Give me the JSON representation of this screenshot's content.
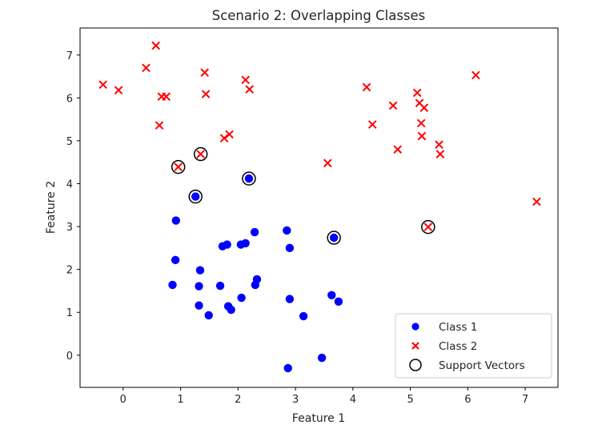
{
  "chart_data": {
    "type": "scatter",
    "title": "Scenario 2: Overlapping Classes",
    "xlabel": "Feature 1",
    "ylabel": "Feature 2",
    "xlim": [
      -0.75,
      7.57
    ],
    "ylim": [
      -0.75,
      7.63
    ],
    "xticks": [
      0,
      1,
      2,
      3,
      4,
      5,
      6,
      7
    ],
    "yticks": [
      0,
      1,
      2,
      3,
      4,
      5,
      6,
      7
    ],
    "grid": false,
    "legend_position": "bottom-right",
    "legend": [
      {
        "label": "Class 1",
        "marker": "circle-filled",
        "color": "#0000ff"
      },
      {
        "label": "Class 2",
        "marker": "x",
        "color": "#ff0000"
      },
      {
        "label": "Support Vectors",
        "marker": "circle-open",
        "color": "#000000"
      }
    ],
    "series": [
      {
        "name": "Class 1",
        "marker": "circle-filled",
        "color": "#0000ff",
        "points": [
          [
            0.92,
            3.14
          ],
          [
            2.29,
            2.87
          ],
          [
            2.85,
            2.91
          ],
          [
            1.73,
            2.54
          ],
          [
            1.81,
            2.58
          ],
          [
            2.05,
            2.58
          ],
          [
            2.13,
            2.61
          ],
          [
            2.9,
            2.5
          ],
          [
            0.91,
            2.22
          ],
          [
            1.34,
            1.98
          ],
          [
            0.86,
            1.64
          ],
          [
            1.32,
            1.61
          ],
          [
            1.69,
            1.62
          ],
          [
            2.33,
            1.77
          ],
          [
            2.3,
            1.64
          ],
          [
            2.06,
            1.34
          ],
          [
            2.9,
            1.31
          ],
          [
            3.63,
            1.4
          ],
          [
            3.75,
            1.25
          ],
          [
            1.32,
            1.16
          ],
          [
            1.49,
            0.93
          ],
          [
            1.83,
            1.14
          ],
          [
            1.88,
            1.06
          ],
          [
            3.14,
            0.91
          ],
          [
            3.46,
            -0.06
          ],
          [
            2.87,
            -0.3
          ],
          [
            1.26,
            3.7
          ],
          [
            2.19,
            4.12
          ],
          [
            3.67,
            2.74
          ]
        ]
      },
      {
        "name": "Class 2",
        "marker": "x",
        "color": "#ff0000",
        "points": [
          [
            0.57,
            7.22
          ],
          [
            0.4,
            6.7
          ],
          [
            -0.35,
            6.31
          ],
          [
            -0.08,
            6.18
          ],
          [
            0.67,
            6.03
          ],
          [
            0.75,
            6.03
          ],
          [
            1.42,
            6.59
          ],
          [
            1.44,
            6.09
          ],
          [
            2.13,
            6.42
          ],
          [
            2.2,
            6.2
          ],
          [
            0.63,
            5.36
          ],
          [
            1.76,
            5.06
          ],
          [
            1.85,
            5.15
          ],
          [
            0.96,
            4.39
          ],
          [
            1.35,
            4.69
          ],
          [
            4.24,
            6.25
          ],
          [
            6.14,
            6.53
          ],
          [
            5.12,
            6.12
          ],
          [
            4.7,
            5.82
          ],
          [
            5.16,
            5.88
          ],
          [
            5.24,
            5.77
          ],
          [
            4.34,
            5.38
          ],
          [
            5.19,
            5.41
          ],
          [
            5.2,
            5.11
          ],
          [
            5.5,
            4.91
          ],
          [
            4.78,
            4.8
          ],
          [
            5.52,
            4.69
          ],
          [
            3.56,
            4.48
          ],
          [
            7.2,
            3.58
          ],
          [
            5.31,
            2.99
          ]
        ]
      },
      {
        "name": "Support Vectors",
        "marker": "circle-open",
        "color": "#000000",
        "points": [
          [
            1.26,
            3.7
          ],
          [
            2.19,
            4.12
          ],
          [
            3.67,
            2.74
          ],
          [
            0.96,
            4.39
          ],
          [
            1.35,
            4.69
          ],
          [
            5.31,
            2.99
          ]
        ]
      }
    ]
  }
}
